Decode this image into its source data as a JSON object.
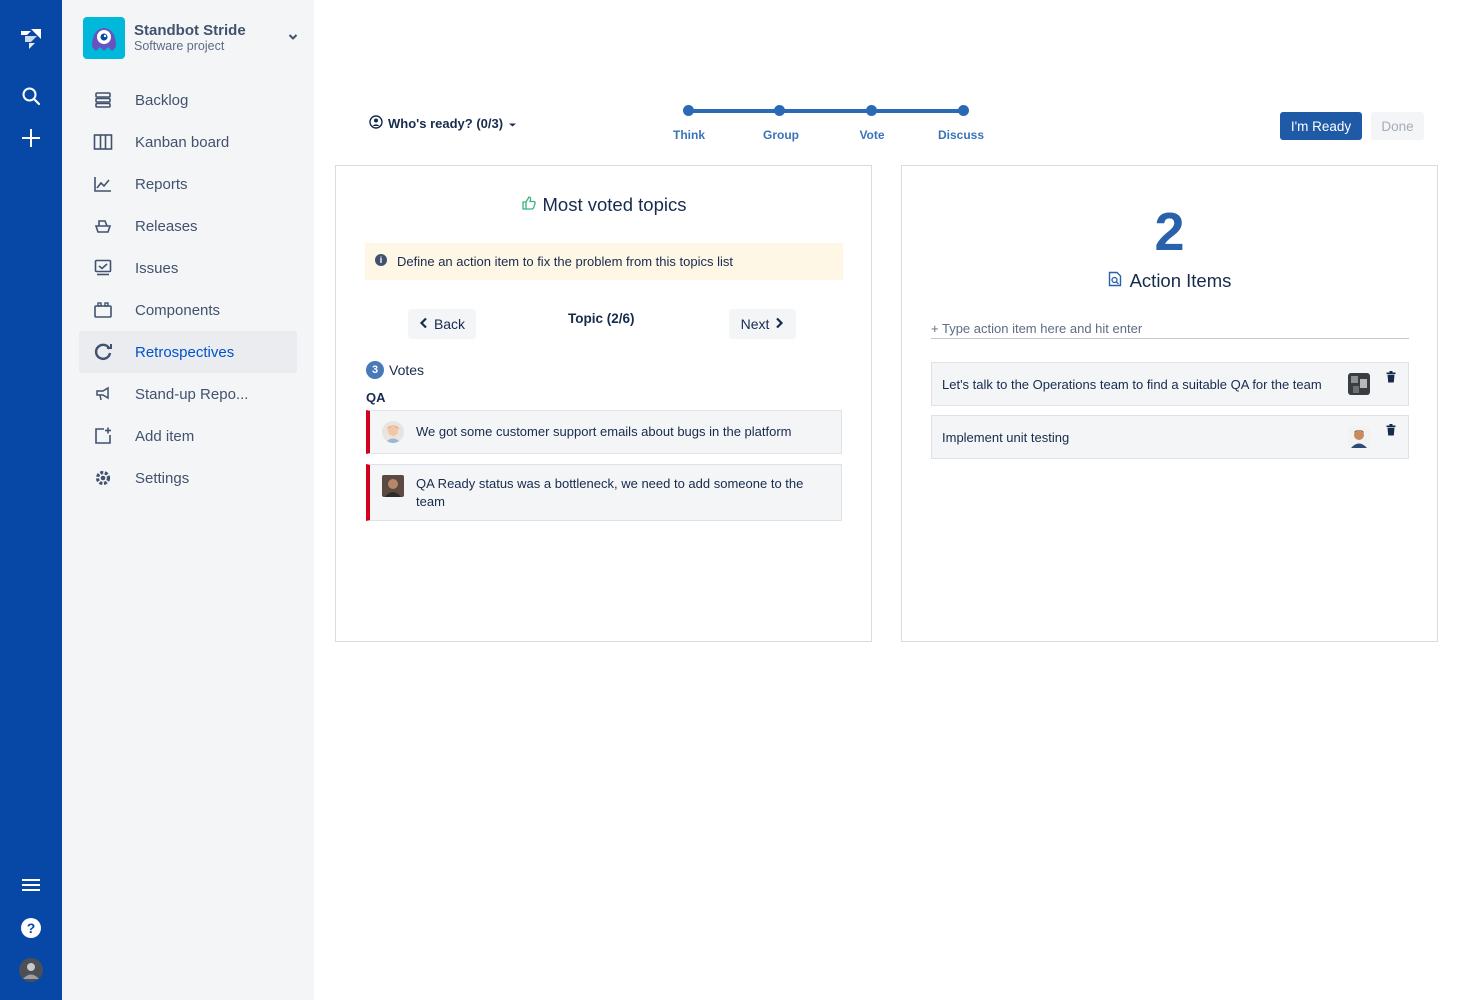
{
  "project": {
    "name": "Standbot Stride",
    "type": "Software project"
  },
  "sidebar": {
    "items": [
      {
        "label": "Backlog",
        "icon": "backlog-icon"
      },
      {
        "label": "Kanban board",
        "icon": "kanban-board-icon"
      },
      {
        "label": "Reports",
        "icon": "reports-icon"
      },
      {
        "label": "Releases",
        "icon": "releases-icon"
      },
      {
        "label": "Issues",
        "icon": "issues-icon"
      },
      {
        "label": "Components",
        "icon": "components-icon"
      },
      {
        "label": "Retrospectives",
        "icon": "retrospectives-icon",
        "active": true
      },
      {
        "label": "Stand-up Repo...",
        "icon": "standup-megaphone-icon"
      },
      {
        "label": "Add item",
        "icon": "add-item-icon"
      },
      {
        "label": "Settings",
        "icon": "settings-gear-icon"
      }
    ]
  },
  "header": {
    "whos_ready": "Who's ready? (0/3)",
    "steps": [
      "Think",
      "Group",
      "Vote",
      "Discuss"
    ],
    "ready_button": "I'm Ready",
    "done_button": "Done"
  },
  "topics": {
    "title": "Most voted topics",
    "info": "Define an action item to fix the problem from this topics list",
    "back": "Back",
    "next": "Next",
    "counter": "Topic (2/6)",
    "vote_count": "3",
    "votes_label": "Votes",
    "group": "QA",
    "cards": [
      "We got some customer support emails about bugs in the platform",
      "QA Ready status was a bottleneck, we need to add someone to the team"
    ]
  },
  "action_items": {
    "count": "2",
    "title": "Action Items",
    "placeholder": "+ Type action item here and hit enter",
    "items": [
      "Let's talk to the Operations team to find a suitable QA for the team",
      "Implement unit testing"
    ]
  },
  "colors": {
    "rail": "#0747a6",
    "accent": "#0052cc",
    "topic_border": "#d0021b",
    "step": "#2a6ab4"
  }
}
